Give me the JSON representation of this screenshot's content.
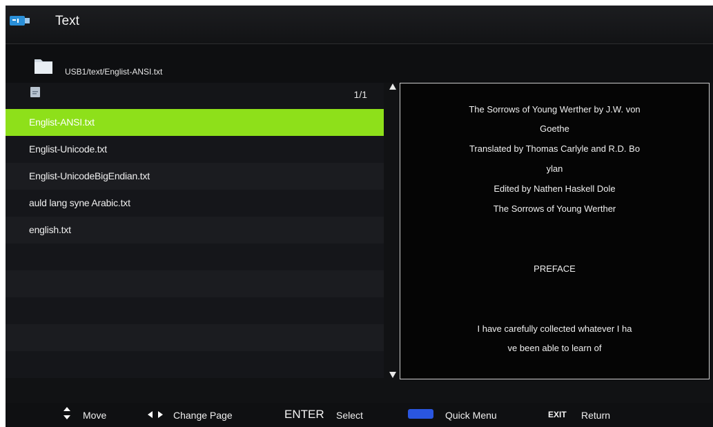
{
  "header": {
    "title": "Text",
    "usb_icon": "usb-drive-icon"
  },
  "path": {
    "folder_icon": "folder-icon",
    "current_path": "USB1/text/Englist-ANSI.txt"
  },
  "file_list": {
    "page_indicator": "1/1",
    "selected_index": 0,
    "items": [
      "Englist-ANSI.txt",
      "Englist-Unicode.txt",
      "Englist-UnicodeBigEndian.txt",
      "auld lang syne Arabic.txt",
      "english.txt"
    ]
  },
  "preview": {
    "lines": [
      "The Sorrows of Young Werther by J.W. von",
      "Goethe",
      "Translated by Thomas Carlyle and R.D. Bo",
      "ylan",
      "Edited by Nathen Haskell Dole",
      "The Sorrows of Young Werther",
      "PREFACE",
      "I have carefully collected whatever I ha",
      "ve been able to learn of"
    ]
  },
  "hints": {
    "move": "Move",
    "change_page": "Change Page",
    "enter_key": "ENTER",
    "select": "Select",
    "quick_menu": "Quick Menu",
    "exit_key": "EXIT",
    "return": "Return"
  },
  "colors": {
    "selection": "#8ee01a",
    "background": "#111214",
    "quick_menu_key": "#2a56e0"
  }
}
